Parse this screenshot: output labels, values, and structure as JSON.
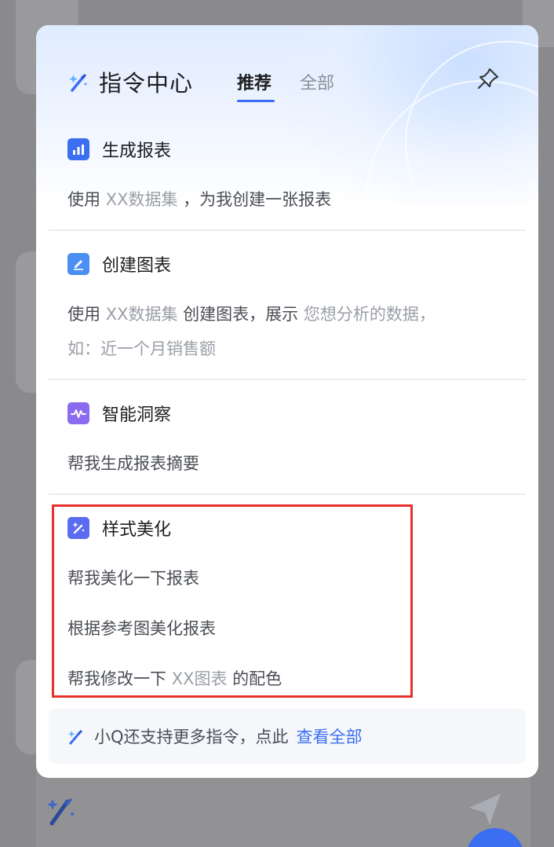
{
  "panel": {
    "title": "指令中心",
    "tabs": [
      "推荐",
      "全部"
    ],
    "active_tab": "推荐"
  },
  "sections": [
    {
      "title": "生成报表",
      "icon": "bar-chart-icon",
      "icon_color": "#3b6ef0",
      "prompts": [
        {
          "parts": [
            {
              "text": "使用 ",
              "var": false
            },
            {
              "text": "XX数据集",
              "var": true
            },
            {
              "text": " ，为我创建一张报表",
              "var": false
            }
          ]
        }
      ]
    },
    {
      "title": "创建图表",
      "icon": "edit-chart-icon",
      "icon_color": "#4b8ff5",
      "prompts": [
        {
          "parts": [
            {
              "text": "使用 ",
              "var": false
            },
            {
              "text": "XX数据集",
              "var": true
            },
            {
              "text": " 创建图表，展示 ",
              "var": false
            },
            {
              "text": "您想分析的数据，",
              "var": true
            }
          ]
        },
        {
          "parts": [
            {
              "text": "如：近一个月销售额",
              "var": true
            }
          ]
        }
      ]
    },
    {
      "title": "智能洞察",
      "icon": "pulse-icon",
      "icon_color": "#8b6cf0",
      "prompts": [
        {
          "parts": [
            {
              "text": "帮我生成报表摘要",
              "var": false
            }
          ]
        }
      ]
    },
    {
      "title": "样式美化",
      "icon": "magic-wand-icon",
      "icon_color": "#5b6cf0",
      "prompts": [
        {
          "parts": [
            {
              "text": "帮我美化一下报表",
              "var": false
            }
          ]
        },
        {
          "parts": [
            {
              "text": "根据参考图美化报表",
              "var": false
            }
          ]
        },
        {
          "parts": [
            {
              "text": "帮我修改一下 ",
              "var": false
            },
            {
              "text": "XX图表",
              "var": true
            },
            {
              "text": " 的配色",
              "var": false
            }
          ]
        }
      ]
    }
  ],
  "footer": {
    "text": "小Q还支持更多指令，点此",
    "link": "查看全部"
  },
  "colors": {
    "accent": "#3b6ef0",
    "highlight_border": "#e8302c"
  }
}
